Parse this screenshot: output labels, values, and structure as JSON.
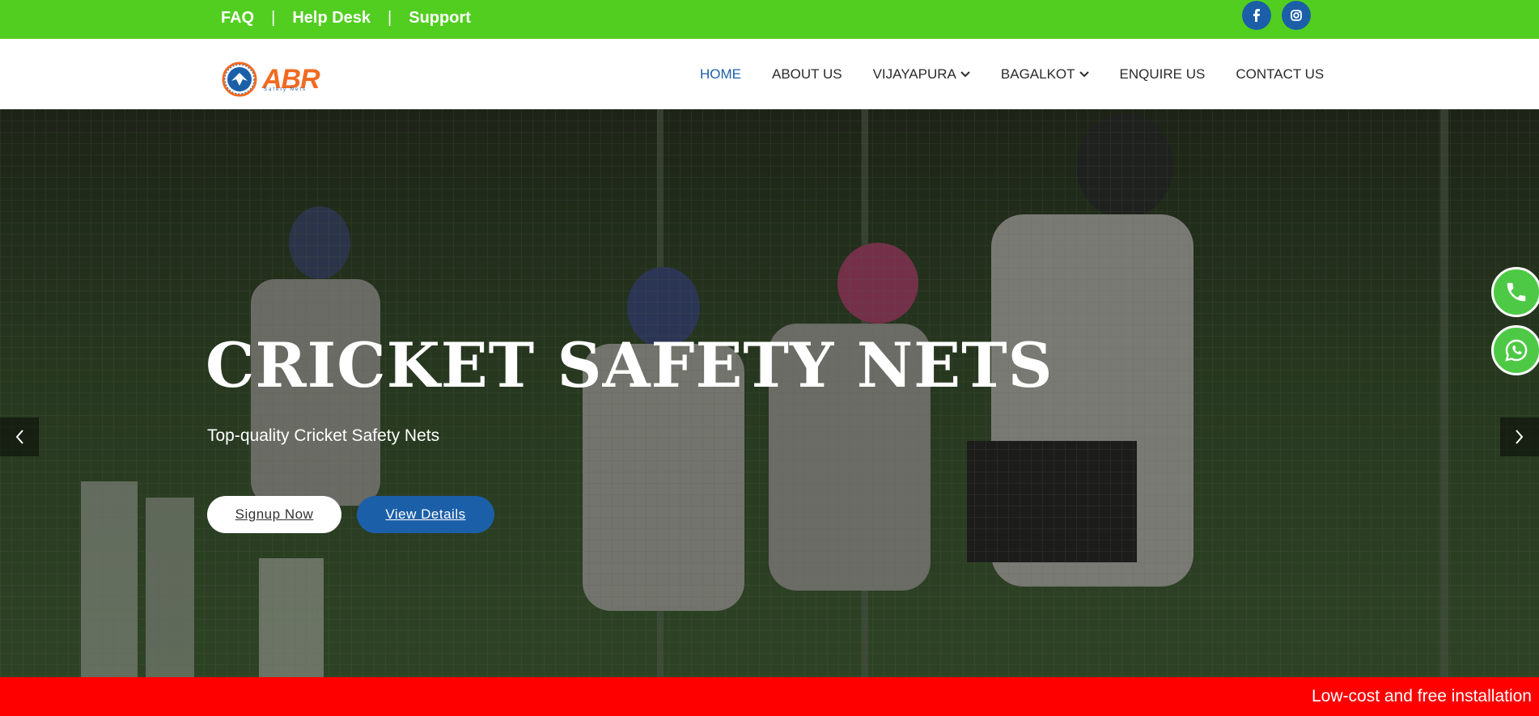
{
  "topbar": {
    "links": [
      "FAQ",
      "Help Desk",
      "Support"
    ],
    "separator": "|",
    "social": [
      "facebook-icon",
      "instagram-icon"
    ],
    "bg_color": "#52ce20"
  },
  "header": {
    "logo_text": "ABR",
    "logo_subtext": "Safety Nets",
    "nav": [
      {
        "label": "HOME",
        "active": true
      },
      {
        "label": "ABOUT US"
      },
      {
        "label": "VIJAYAPURA",
        "dropdown": true
      },
      {
        "label": "BAGALKOT",
        "dropdown": true
      },
      {
        "label": "ENQUIRE US"
      },
      {
        "label": "CONTACT US"
      }
    ]
  },
  "hero": {
    "title": "CRICKET SAFETY NETS",
    "subtitle": "Top-quality Cricket Safety Nets",
    "buttons": {
      "signup": "Signup Now",
      "view": "View Details"
    },
    "accent_color": "#1b5fa8"
  },
  "floating": {
    "phone": "phone-icon",
    "whatsapp": "whatsapp-icon"
  },
  "ticker": {
    "text": "Low-cost and free installation",
    "bg_color": "#ff0000"
  }
}
